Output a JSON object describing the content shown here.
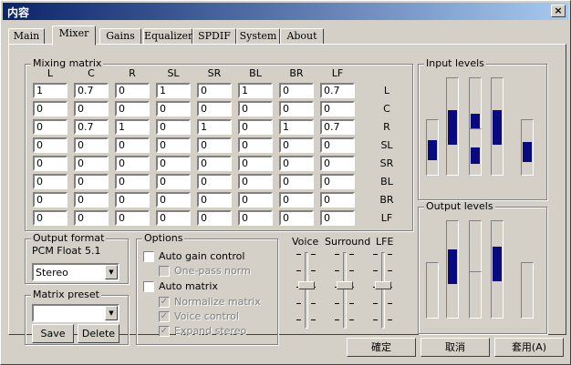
{
  "window": {
    "title": "内容",
    "close_glyph": "×"
  },
  "tabs": [
    "Main",
    "Mixer",
    "Gains",
    "Equalizer",
    "SPDIF",
    "System",
    "About"
  ],
  "active_tab": "Mixer",
  "mixing_matrix": {
    "label": "Mixing matrix",
    "columns": [
      "L",
      "C",
      "R",
      "SL",
      "SR",
      "BL",
      "BR",
      "LF"
    ],
    "rows": [
      "L",
      "C",
      "R",
      "SL",
      "SR",
      "BL",
      "BR",
      "LF"
    ],
    "cells": [
      [
        "1",
        "0.7",
        "0",
        "1",
        "0",
        "1",
        "0",
        "0.7"
      ],
      [
        "0",
        "0",
        "0",
        "0",
        "0",
        "0",
        "0",
        "0"
      ],
      [
        "0",
        "0.7",
        "1",
        "0",
        "1",
        "0",
        "1",
        "0.7"
      ],
      [
        "0",
        "0",
        "0",
        "0",
        "0",
        "0",
        "0",
        "0"
      ],
      [
        "0",
        "0",
        "0",
        "0",
        "0",
        "0",
        "0",
        "0"
      ],
      [
        "0",
        "0",
        "0",
        "0",
        "0",
        "0",
        "0",
        "0"
      ],
      [
        "0",
        "0",
        "0",
        "0",
        "0",
        "0",
        "0",
        "0"
      ],
      [
        "0",
        "0",
        "0",
        "0",
        "0",
        "0",
        "0",
        "0"
      ]
    ]
  },
  "input_levels": {
    "label": "Input levels",
    "levels": [
      0.45,
      0.5,
      0.45,
      0.5,
      0.4,
      0.4
    ]
  },
  "output_levels": {
    "label": "Output levels",
    "levels": [
      0.0,
      0.55,
      0.0,
      0.6,
      0.0,
      0.0
    ]
  },
  "output_format": {
    "label": "Output format",
    "format_text": "PCM Float 5.1",
    "selected": "Stereo"
  },
  "matrix_preset": {
    "label": "Matrix preset",
    "selected": "",
    "save_label": "Save",
    "delete_label": "Delete"
  },
  "options": {
    "label": "Options",
    "auto_gain_control": "Auto gain control",
    "one_pass_norm": "One-pass norm",
    "auto_matrix": "Auto matrix",
    "normalize_matrix": "Normalize matrix",
    "voice_control": "Voice control",
    "expand_stereo": "Expand stereo",
    "check_glyph": "✓"
  },
  "sliders": {
    "voice": "Voice",
    "surround": "Surround",
    "lfe": "LFE"
  },
  "dropdown_glyph": "▼",
  "footer": {
    "ok_label": "確定",
    "cancel_label": "取消",
    "apply_label": "套用(A)"
  }
}
